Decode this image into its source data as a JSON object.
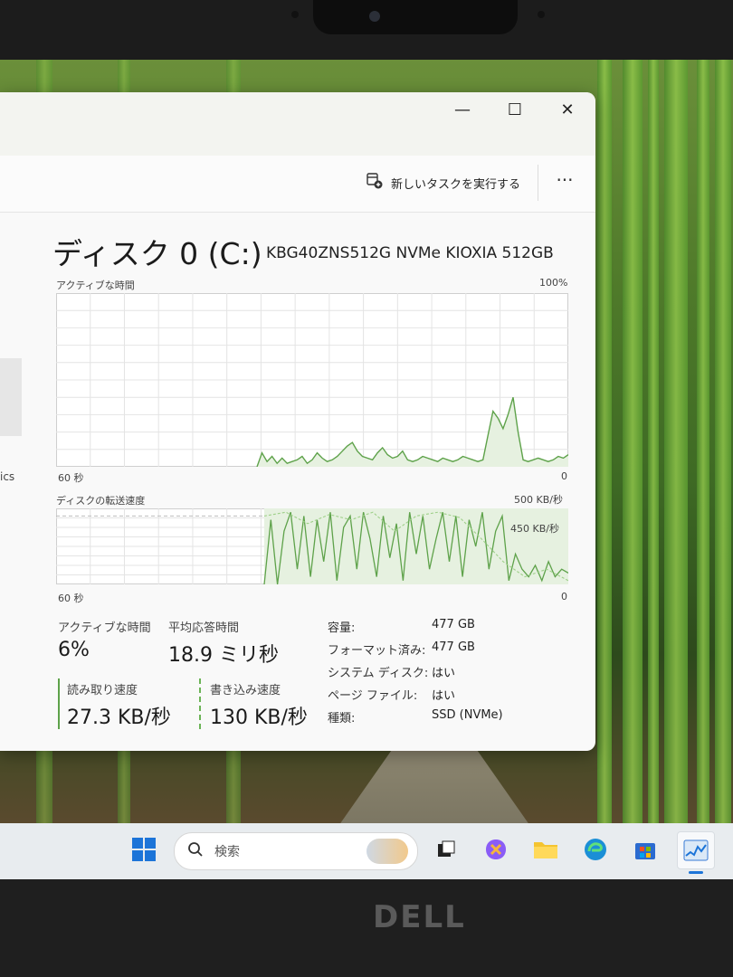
{
  "window": {
    "controls": {
      "minimize": "—",
      "maximize": "☐",
      "close": "✕"
    },
    "toolbar": {
      "new_task_label": "新しいタスクを実行する",
      "more": "···"
    },
    "sidebar": {
      "partial_label": "ics"
    }
  },
  "disk": {
    "title": "ディスク 0 (C:)",
    "model": "KBG40ZNS512G NVMe KIOXIA 512GB"
  },
  "graphs": {
    "active_time": {
      "label": "アクティブな時間",
      "max_label": "100%",
      "time_label": "60 秒",
      "min_label": "0",
      "values": [
        0,
        0,
        0,
        0,
        0,
        0,
        0,
        0,
        0,
        0,
        0,
        0,
        0,
        0,
        0,
        0,
        0,
        0,
        0,
        0,
        0,
        0,
        0,
        0,
        0,
        0,
        0,
        0,
        0,
        0,
        0,
        0,
        0,
        0,
        0,
        0,
        0,
        0,
        0,
        0,
        0,
        8,
        3,
        6,
        2,
        5,
        2,
        3,
        4,
        6,
        2,
        4,
        8,
        5,
        3,
        4,
        6,
        9,
        12,
        14,
        9,
        6,
        5,
        4,
        8,
        11,
        7,
        5,
        6,
        9,
        4,
        3,
        4,
        6,
        5,
        4,
        3,
        5,
        4,
        3,
        4,
        6,
        5,
        4,
        3,
        4,
        18,
        32,
        28,
        22,
        30,
        40,
        20,
        4,
        3,
        4,
        5,
        4,
        3,
        4,
        6,
        5,
        7
      ]
    },
    "transfer_rate": {
      "label": "ディスクの転送速度",
      "max_label": "500 KB/秒",
      "ref_label": "450 KB/秒",
      "time_label": "60 秒",
      "min_label": "0"
    }
  },
  "stats": {
    "active_time": {
      "label": "アクティブな時間",
      "value": "6%"
    },
    "avg_response": {
      "label": "平均応答時間",
      "value": "18.9 ミリ秒"
    },
    "read_speed": {
      "label": "読み取り速度",
      "value": "27.3 KB/秒"
    },
    "write_speed": {
      "label": "書き込み速度",
      "value": "130 KB/秒"
    }
  },
  "properties": [
    {
      "key": "容量:",
      "value": "477 GB"
    },
    {
      "key": "フォーマット済み:",
      "value": "477 GB"
    },
    {
      "key": "システム ディスク:",
      "value": "はい"
    },
    {
      "key": "ページ ファイル:",
      "value": "はい"
    },
    {
      "key": "種類:",
      "value": "SSD (NVMe)"
    }
  ],
  "taskbar": {
    "search_placeholder": "検索"
  },
  "brand": "DELL",
  "colors": {
    "accent_green": "#5ea24a",
    "graph_fill": "#e6f1e0",
    "grid": "#d9d9d9"
  }
}
